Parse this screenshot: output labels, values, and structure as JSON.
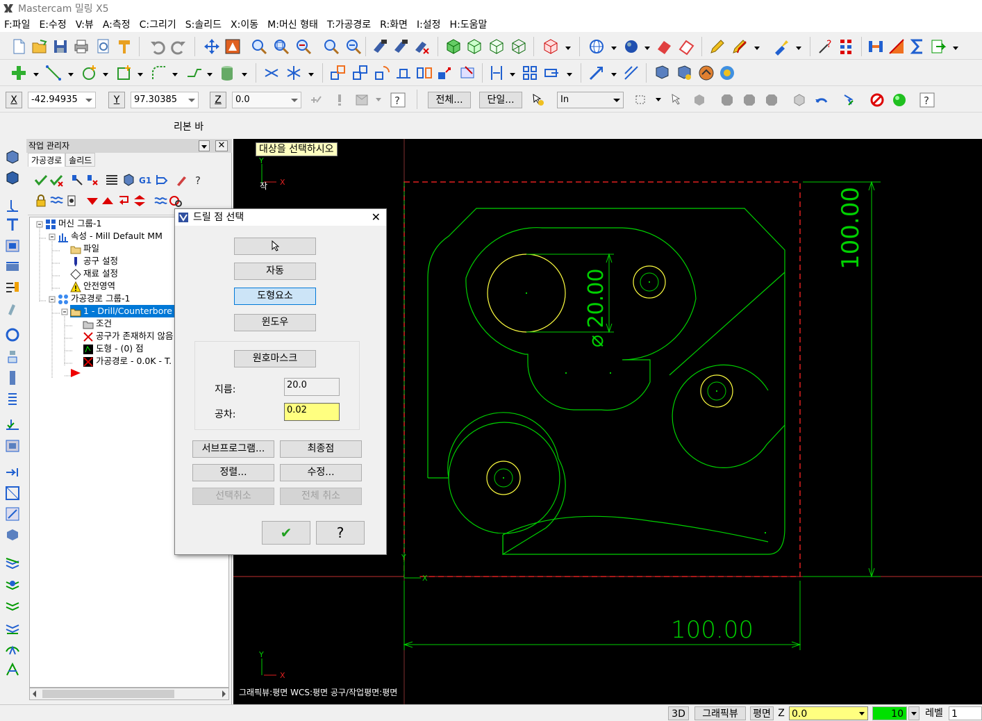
{
  "app": {
    "title": "Mastercam 밀링 X5"
  },
  "menu": [
    "F:파일",
    "E:수정",
    "V:뷰",
    "A:측정",
    "C:그리기",
    "S:솔리드",
    "X:이동",
    "M:머신 형태",
    "T:가공경로",
    "R:화면",
    "I:설정",
    "H:도움말"
  ],
  "coords": {
    "x_label": "X",
    "x_value": "-42.94935",
    "y_label": "Y",
    "y_value": "97.30385",
    "z_label": "Z",
    "z_value": "0.0",
    "all_label": "전체...",
    "single_label": "단일...",
    "unit_value": "In"
  },
  "ribbon": {
    "label": "리본 바"
  },
  "ops_manager": {
    "title": "작업 관리자",
    "tabs": [
      "가공경로",
      "솔리드"
    ],
    "tree": [
      {
        "label": "머신 그룹-1"
      },
      {
        "label": "속성 - Mill Default MM"
      },
      {
        "label": "파일"
      },
      {
        "label": "공구 설정"
      },
      {
        "label": "재료 설정"
      },
      {
        "label": "안전영역"
      },
      {
        "label": "가공경로 그룹-1"
      },
      {
        "label": "1 - Drill/Counterbore -"
      },
      {
        "label": "조건"
      },
      {
        "label": "공구가 존재하지 않음"
      },
      {
        "label": "도형 - (0) 점"
      },
      {
        "label": "가공경로 - 0.0K - T."
      }
    ]
  },
  "viewport": {
    "prompt": "대상을 선택하시오",
    "dim_width": "100.00",
    "dim_height": "100.00",
    "dim_dia": "⌀ 20.00",
    "axis_x": "X",
    "axis_y": "Y",
    "top_axis_extra": "작",
    "status_line": "그래픽뷰:평면   WCS:평면   공구/작업평면:평면"
  },
  "dialog": {
    "title": "드릴 점 선택",
    "btn_manual": "",
    "btn_auto": "자동",
    "btn_entity": "도형요소",
    "btn_window": "윈도우",
    "btn_arcmask": "원호마스크",
    "diameter_label": "지름:",
    "diameter_value": "20.0",
    "tolerance_label": "공차:",
    "tolerance_value": "0.02",
    "btn_subprogram": "서브프로그램...",
    "btn_last": "최종점",
    "btn_sort": "정렬...",
    "btn_modify": "수정...",
    "btn_unselect": "선택취소",
    "btn_unselect_all": "전체 취소",
    "btn_ok": "✔",
    "btn_help": "?"
  },
  "statusbar": {
    "view3d": "3D",
    "graphic_view": "그래픽뷰",
    "plane": "평면",
    "z_label": "Z",
    "z_value": "0.0",
    "color_value": "10",
    "level_label": "레벨",
    "level_value": "1"
  },
  "colors": {
    "geometry": "#00e000",
    "selected": "#ffff40",
    "axis": "#ff3030",
    "highlight": "#0078d7"
  }
}
